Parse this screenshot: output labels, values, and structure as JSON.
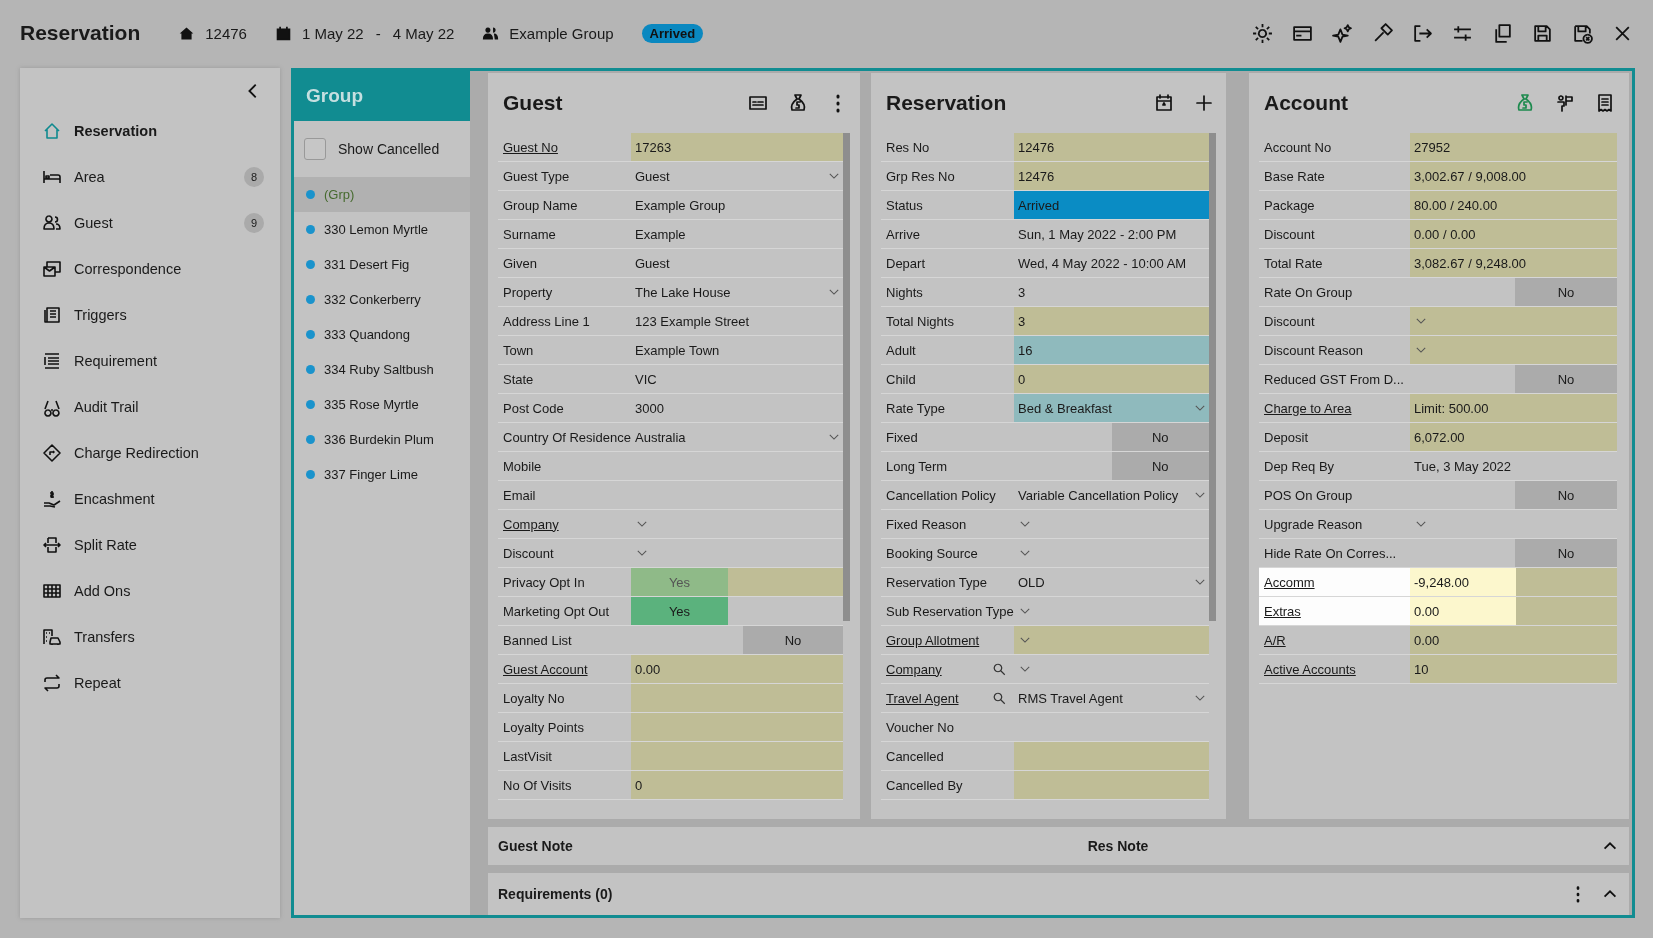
{
  "header": {
    "title": "Reservation",
    "res_no": "12476",
    "date_from": "1 May 22",
    "date_sep": "-",
    "date_to": "4 May 22",
    "group": "Example Group",
    "status": "Arrived"
  },
  "sidebar": {
    "items": [
      {
        "label": "Reservation",
        "selected": true
      },
      {
        "label": "Area",
        "count": "8",
        "selected": false
      },
      {
        "label": "Guest",
        "count": "9",
        "selected": false
      },
      {
        "label": "Correspondence",
        "selected": false
      },
      {
        "label": "Triggers",
        "selected": false
      },
      {
        "label": "Requirement",
        "selected": false
      },
      {
        "label": "Audit Trail",
        "selected": false
      },
      {
        "label": "Charge Redirection",
        "selected": false
      },
      {
        "label": "Encashment",
        "selected": false
      },
      {
        "label": "Split Rate",
        "selected": false
      },
      {
        "label": "Add Ons",
        "selected": false
      },
      {
        "label": "Transfers",
        "selected": false
      },
      {
        "label": "Repeat",
        "selected": false
      }
    ]
  },
  "group_panel": {
    "title": "Group",
    "show_cancelled": {
      "label": "Show Cancelled",
      "checked": false
    },
    "items": [
      {
        "label": "(Grp)",
        "selected": true
      },
      {
        "label": "330 Lemon Myrtle",
        "selected": false
      },
      {
        "label": "331 Desert Fig",
        "selected": false
      },
      {
        "label": "332 Conkerberry",
        "selected": false
      },
      {
        "label": "333 Quandong",
        "selected": false
      },
      {
        "label": "334 Ruby Saltbush",
        "selected": false
      },
      {
        "label": "335 Rose Myrtle",
        "selected": false
      },
      {
        "label": "336 Burdekin Plum",
        "selected": false
      },
      {
        "label": "337 Finger Lime",
        "selected": false
      }
    ]
  },
  "guest": {
    "title": "Guest",
    "rows": [
      {
        "label": "Guest No",
        "link": true,
        "value": "17263",
        "kind": "text",
        "color": "#bfbd96"
      },
      {
        "label": "Guest Type",
        "link": false,
        "value": "Guest",
        "kind": "select",
        "color": "#c3c3c3"
      },
      {
        "label": "Group Name",
        "link": false,
        "value": "Example Group",
        "kind": "text",
        "color": "#c3c3c3"
      },
      {
        "label": "Surname",
        "link": false,
        "value": "Example",
        "kind": "text",
        "color": "#c3c3c3"
      },
      {
        "label": "Given",
        "link": false,
        "value": "Guest",
        "kind": "text",
        "color": "#c3c3c3"
      },
      {
        "label": "Property",
        "link": false,
        "value": "The Lake House",
        "kind": "select",
        "color": "#c3c3c3"
      },
      {
        "label": "Address Line 1",
        "link": false,
        "value": "123 Example Street",
        "kind": "text",
        "color": "#c3c3c3"
      },
      {
        "label": "Town",
        "link": false,
        "value": "Example Town",
        "kind": "text",
        "color": "#c3c3c3"
      },
      {
        "label": "State",
        "link": false,
        "value": "VIC",
        "kind": "text",
        "color": "#c3c3c3"
      },
      {
        "label": "Post Code",
        "link": false,
        "value": "3000",
        "kind": "text",
        "color": "#c3c3c3"
      },
      {
        "label": "Country Of Residence",
        "link": false,
        "value": "Australia",
        "kind": "select",
        "color": "#c3c3c3"
      },
      {
        "label": "Mobile",
        "link": false,
        "kind": "text",
        "color": "#c3c3c3"
      },
      {
        "label": "Email",
        "link": false,
        "kind": "text",
        "color": "#c3c3c3"
      },
      {
        "label": "Company",
        "link": true,
        "kind": "select",
        "color": "#c3c3c3"
      },
      {
        "label": "Discount",
        "link": false,
        "kind": "select",
        "color": "#c3c3c3"
      },
      {
        "label": "Privacy Opt In",
        "link": false,
        "value": "Yes",
        "kind": "optin",
        "color": "#bfbd96"
      },
      {
        "label": "Marketing Opt Out",
        "link": false,
        "value": "Yes",
        "kind": "optin",
        "color": "#c3c3c3"
      },
      {
        "label": "Banned List",
        "link": false,
        "value": "No",
        "kind": "toggle",
        "color": "#ababab"
      },
      {
        "label": "Guest Account",
        "link": true,
        "value": "0.00",
        "kind": "text",
        "color": "#bfbd96"
      },
      {
        "label": "Loyalty No",
        "link": false,
        "kind": "text",
        "color": "#bfbd96"
      },
      {
        "label": "Loyalty Points",
        "link": false,
        "kind": "text",
        "color": "#bfbd96"
      },
      {
        "label": "LastVisit",
        "link": false,
        "kind": "text",
        "color": "#bfbd96"
      },
      {
        "label": "No Of Visits",
        "link": false,
        "value": "0",
        "kind": "text",
        "color": "#bfbd96"
      }
    ]
  },
  "reservation": {
    "title": "Reservation",
    "rows": [
      {
        "label": "Res No",
        "link": false,
        "value": "12476",
        "kind": "text",
        "color": "#bfbd96"
      },
      {
        "label": "Grp Res No",
        "link": false,
        "value": "12476",
        "kind": "text",
        "color": "#bfbd96"
      },
      {
        "label": "Status",
        "link": false,
        "value": "Arrived",
        "kind": "text",
        "color": "#0a8cc4"
      },
      {
        "label": "Arrive",
        "link": false,
        "value": "Sun, 1 May 2022 - 2:00 PM",
        "kind": "text",
        "color": "#c3c3c3"
      },
      {
        "label": "Depart",
        "link": false,
        "value": "Wed, 4 May 2022 - 10:00 AM",
        "kind": "text",
        "color": "#c3c3c3"
      },
      {
        "label": "Nights",
        "link": false,
        "value": "3",
        "kind": "text",
        "color": "#c3c3c3"
      },
      {
        "label": "Total Nights",
        "link": false,
        "value": "3",
        "kind": "text",
        "color": "#bfbd96"
      },
      {
        "label": "Adult",
        "link": false,
        "value": "16",
        "kind": "text",
        "color": "#8fbabd"
      },
      {
        "label": "Child",
        "link": false,
        "value": "0",
        "kind": "text",
        "color": "#bfbd96"
      },
      {
        "label": "Rate Type",
        "link": false,
        "value": "Bed & Breakfast",
        "kind": "select",
        "color": "#8fbabd"
      },
      {
        "label": "Fixed",
        "link": false,
        "value": "No",
        "kind": "toggle",
        "color": "#ababab"
      },
      {
        "label": "Long Term",
        "link": false,
        "value": "No",
        "kind": "toggle",
        "color": "#ababab"
      },
      {
        "label": "Cancellation Policy",
        "link": false,
        "value": "Variable Cancellation Policy",
        "kind": "select",
        "color": "#c3c3c3"
      },
      {
        "label": "Fixed Reason",
        "link": false,
        "kind": "select",
        "color": "#c3c3c3"
      },
      {
        "label": "Booking Source",
        "link": false,
        "kind": "select",
        "color": "#c3c3c3"
      },
      {
        "label": "Reservation Type",
        "link": false,
        "value": "OLD",
        "kind": "select",
        "color": "#c3c3c3"
      },
      {
        "label": "Sub Reservation Type",
        "link": false,
        "kind": "select",
        "color": "#c3c3c3"
      },
      {
        "label": "Group Allotment",
        "link": true,
        "kind": "select",
        "color": "#bfbd96"
      },
      {
        "label": "Company",
        "link": true,
        "kind": "search-select",
        "color": "#c3c3c3"
      },
      {
        "label": "Travel Agent",
        "link": true,
        "value": "RMS Travel Agent",
        "kind": "search-select",
        "color": "#c3c3c3"
      },
      {
        "label": "Voucher No",
        "link": false,
        "kind": "text",
        "color": "#c3c3c3"
      },
      {
        "label": "Cancelled",
        "link": false,
        "kind": "text",
        "color": "#bfbd96"
      },
      {
        "label": "Cancelled By",
        "link": false,
        "kind": "text",
        "color": "#bfbd96"
      }
    ]
  },
  "account": {
    "title": "Account",
    "rows": [
      {
        "label": "Account No",
        "link": false,
        "value": "27952",
        "kind": "text",
        "color": "#bfbd96",
        "highlighted": false
      },
      {
        "label": "Base Rate",
        "link": false,
        "value": "3,002.67 / 9,008.00",
        "kind": "text",
        "color": "#bfbd96",
        "highlighted": false
      },
      {
        "label": "Package",
        "link": false,
        "value": "80.00 / 240.00",
        "kind": "text",
        "color": "#bfbd96",
        "highlighted": false
      },
      {
        "label": "Discount",
        "link": false,
        "value": "0.00 / 0.00",
        "kind": "text",
        "color": "#bfbd96",
        "highlighted": false
      },
      {
        "label": "Total Rate",
        "link": false,
        "value": "3,082.67 / 9,248.00",
        "kind": "text",
        "color": "#bfbd96",
        "highlighted": false
      },
      {
        "label": "Rate On Group",
        "link": false,
        "value": "No",
        "kind": "toggle",
        "color": "#ababab",
        "highlighted": false
      },
      {
        "label": "Discount",
        "link": false,
        "kind": "select",
        "color": "#bfbd96",
        "highlighted": false
      },
      {
        "label": "Discount Reason",
        "link": false,
        "kind": "select",
        "color": "#bfbd96",
        "highlighted": false
      },
      {
        "label": "Reduced GST From D...",
        "link": false,
        "value": "No",
        "kind": "toggle",
        "color": "#ababab",
        "highlighted": false
      },
      {
        "label": "Charge to Area",
        "link": true,
        "value": "Limit: 500.00",
        "kind": "text",
        "color": "#bfbd96",
        "highlighted": false
      },
      {
        "label": "Deposit",
        "link": false,
        "value": "6,072.00",
        "kind": "text",
        "color": "#bfbd96",
        "highlighted": false
      },
      {
        "label": "Dep Req By",
        "link": false,
        "value": "Tue, 3 May 2022",
        "kind": "text",
        "color": "#c3c3c3",
        "highlighted": false
      },
      {
        "label": "POS On Group",
        "link": false,
        "value": "No",
        "kind": "toggle",
        "color": "#ababab",
        "highlighted": false
      },
      {
        "label": "Upgrade Reason",
        "link": false,
        "kind": "select",
        "color": "#c3c3c3",
        "highlighted": false
      },
      {
        "label": "Hide Rate On Corres...",
        "link": false,
        "value": "No",
        "kind": "toggle",
        "color": "#ababab",
        "highlighted": false
      },
      {
        "label": "Accomm",
        "link": true,
        "value": "-9,248.00",
        "kind": "text",
        "color": "#bfbd96",
        "highlighted": true
      },
      {
        "label": "Extras",
        "link": true,
        "value": "0.00",
        "kind": "text",
        "color": "#bfbd96",
        "highlighted": true
      },
      {
        "label": "A/R",
        "link": true,
        "value": "0.00",
        "kind": "text",
        "color": "#bfbd96",
        "highlighted": false
      },
      {
        "label": "Active Accounts",
        "link": true,
        "value": "10",
        "kind": "text",
        "color": "#bfbd96",
        "highlighted": false
      }
    ]
  },
  "notes": {
    "guest_note": "Guest Note",
    "res_note": "Res Note"
  },
  "requirements": {
    "title": "Requirements (0)"
  }
}
